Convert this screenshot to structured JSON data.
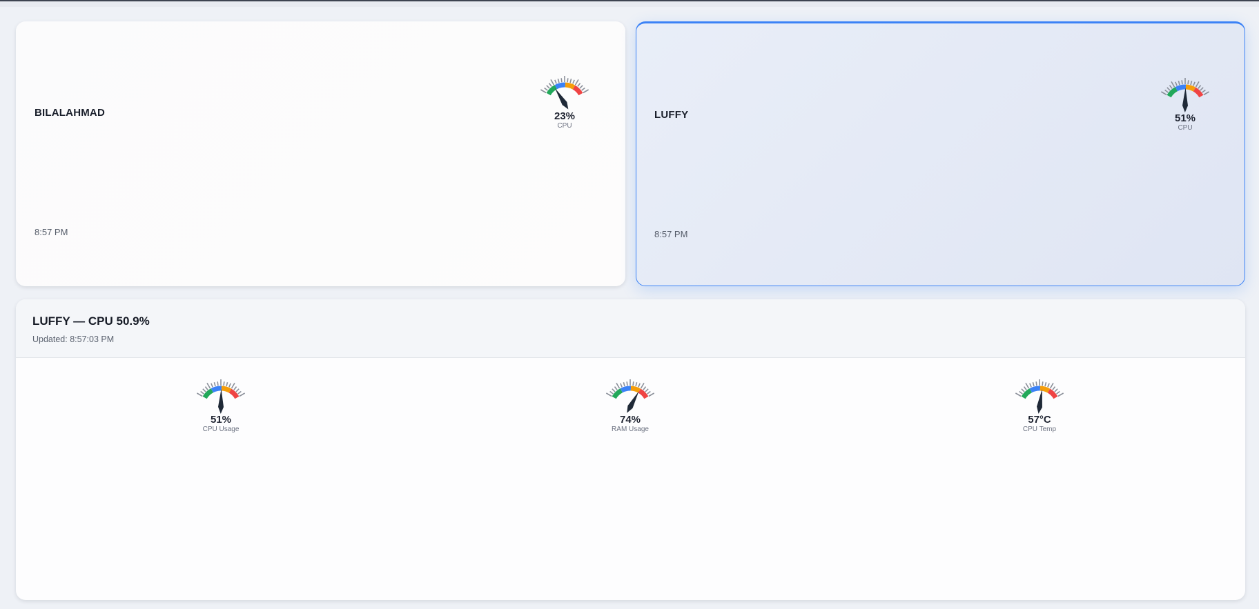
{
  "devices": [
    {
      "name": "BILALAHMAD",
      "time": "8:57 PM",
      "gauge": {
        "value": 23,
        "display": "23%",
        "label": "CPU"
      }
    },
    {
      "name": "LUFFY",
      "time": "8:57 PM",
      "selected": true,
      "gauge": {
        "value": 51,
        "display": "51%",
        "label": "CPU"
      }
    }
  ],
  "detail": {
    "title": "LUFFY — CPU 50.9%",
    "updated": "Updated: 8:57:03 PM",
    "gauges": [
      {
        "value": 51,
        "display": "51%",
        "label": "CPU Usage"
      },
      {
        "value": 74,
        "display": "74%",
        "label": "RAM Usage"
      },
      {
        "value": 57,
        "display": "57°C",
        "label": "CPU Temp"
      }
    ]
  },
  "colors": {
    "accent": "#3b82f6",
    "gauge_segments": [
      "#22a85a",
      "#3b82f6",
      "#f59e0b",
      "#ef4444"
    ],
    "needle": "#1f2937"
  }
}
